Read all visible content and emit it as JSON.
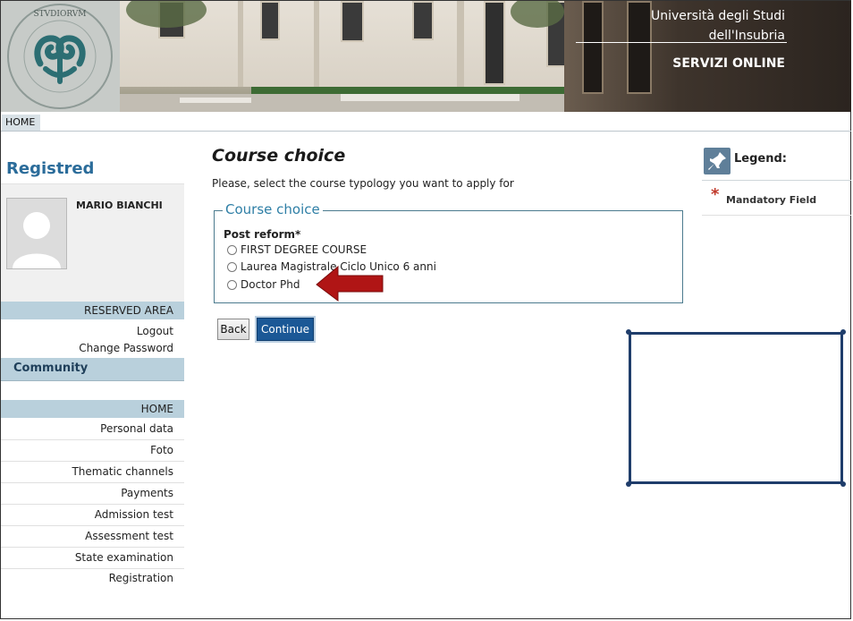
{
  "header": {
    "university_line1": "Università degli Studi",
    "university_line2": "dell'Insubria",
    "services": "SERVIZI ONLINE",
    "logo_icon": "university-seal-icon"
  },
  "breadcrumb": {
    "home": "HOME"
  },
  "sidebar": {
    "title": "Registred",
    "user_name": "MARIO BIANCHI",
    "reserved_area": "RESERVED AREA",
    "reserved_links": [
      "Logout",
      "Change Password"
    ],
    "community": "Community",
    "home": "HOME",
    "menu": [
      "Personal data",
      "Foto",
      "Thematic channels",
      "Payments",
      "Admission test",
      "Assessment test",
      "State examination",
      "Registration"
    ]
  },
  "main": {
    "title": "Course choice",
    "intro": "Please, select the course typology you want to apply for",
    "fieldset_legend": "Course choice",
    "group_label": "Post reform*",
    "options": [
      "FIRST DEGREE COURSE",
      "Laurea Magistrale Ciclo Unico 6 anni",
      "Doctor Phd"
    ],
    "back_label": "Back",
    "continue_label": "Continue"
  },
  "legend": {
    "title": "Legend:",
    "mandatory_symbol": "*",
    "mandatory_label": "Mandatory Field"
  },
  "colors": {
    "accent": "#2b6c9a",
    "sidebar_band": "#b9d0dc",
    "continue_button": "#1b5896",
    "annotation_arrow": "#b01515",
    "annotation_box": "#1f3d6b"
  }
}
